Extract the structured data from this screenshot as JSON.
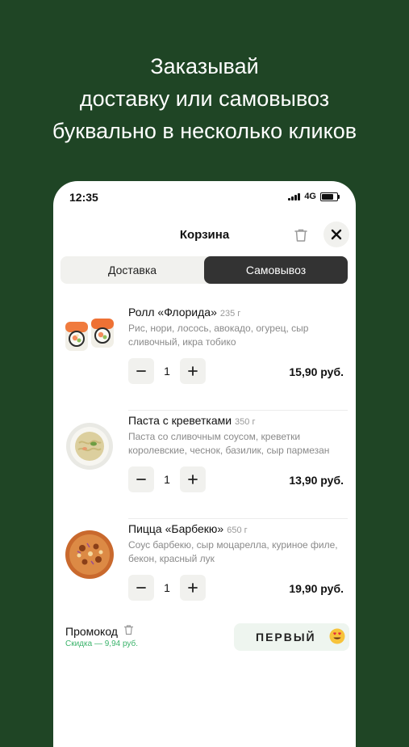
{
  "headline": {
    "lines": [
      "Заказывай",
      "доставку или самовывоз",
      "буквально в несколько кликов"
    ]
  },
  "status_bar": {
    "time": "12:35",
    "network": "4G"
  },
  "cart": {
    "title": "Корзина",
    "tabs": [
      {
        "label": "Доставка",
        "active": false
      },
      {
        "label": "Самовывоз",
        "active": true
      }
    ],
    "items": [
      {
        "name": "Ролл «Флорида»",
        "weight": "235 г",
        "description": "Рис, нори, лосось, авокадо, огурец, сыр сливочный, икра тобико",
        "quantity": "1",
        "price": "15,90 руб.",
        "image": "roll-image"
      },
      {
        "name": "Паста с креветками",
        "weight": "350 г",
        "description": "Паста со сливочным соусом, креветки королевские, чеснок, базилик, сыр пармезан",
        "quantity": "1",
        "price": "13,90 руб.",
        "image": "pasta-image"
      },
      {
        "name": "Пицца «Барбекю»",
        "weight": "650 г",
        "description": "Соус барбекю, сыр моцарелла, куриное филе, бекон, красный лук",
        "quantity": "1",
        "price": "19,90 руб.",
        "image": "pizza-image"
      }
    ],
    "promo": {
      "label": "Промокод",
      "discount": "Скидка — 9,94 руб.",
      "code": "ПЕРВЫЙ",
      "emoji": "heart-eyes-emoji"
    }
  },
  "colors": {
    "background": "#1f4525",
    "active_tab": "#333333",
    "discount_green": "#3bb36b",
    "promo_bg": "#eef5ef"
  }
}
